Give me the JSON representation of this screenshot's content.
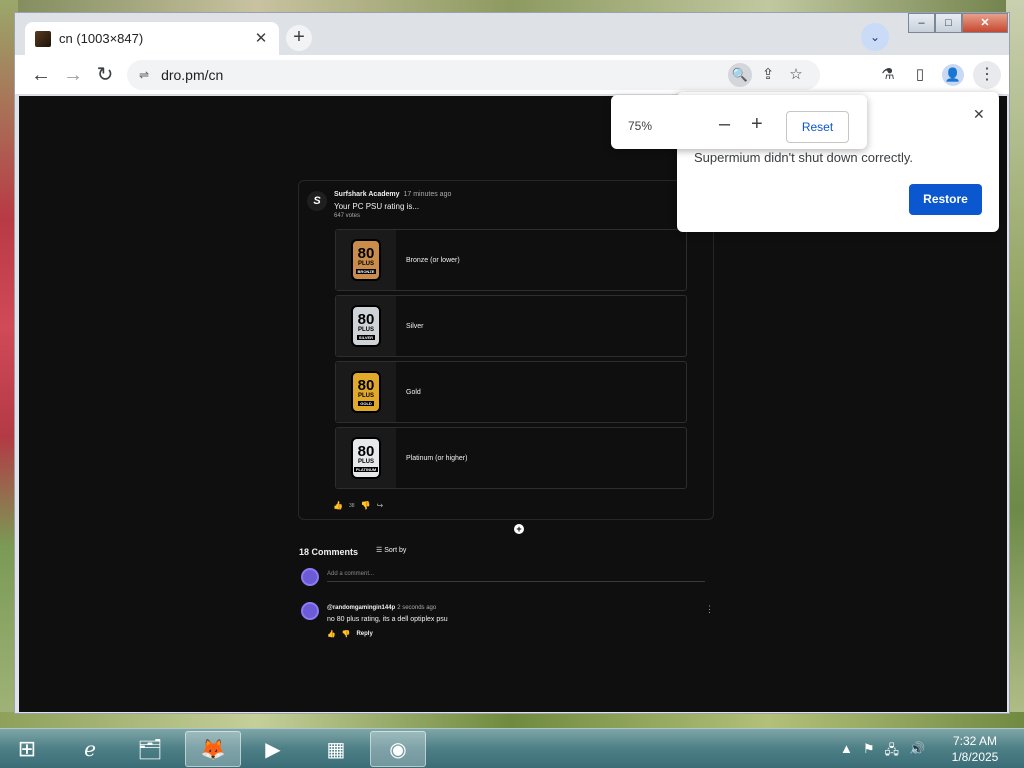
{
  "browser": {
    "tab_title": "cn (1003×847)",
    "tab_close": "✕",
    "new_tab": "+",
    "tab_search": "⌄",
    "url": "dro.pm/cn",
    "window_controls": {
      "minimize": "–",
      "maximize": "□",
      "close": "✕"
    }
  },
  "toolbar": {
    "back": "←",
    "forward": "→",
    "reload": "↻",
    "site_info": "⇌",
    "zoom": "🔍",
    "share": "⇪",
    "bookmark": "☆",
    "labs": "⚗",
    "side_panel": "▯",
    "profile": "👤",
    "menu": "⋮"
  },
  "zoom_popup": {
    "level": "75%",
    "minus": "–",
    "plus": "+",
    "reset": "Reset"
  },
  "restore_popup": {
    "close": "✕",
    "message": "Supermium didn't shut down correctly.",
    "restore": "Restore"
  },
  "post": {
    "channel": "Surfshark Academy",
    "time": "17 minutes ago",
    "question": "Your PC PSU rating is...",
    "votes": "647 votes",
    "avatar_letter": "S",
    "options": [
      {
        "label": "Bronze (or lower)",
        "badge_num": "80",
        "badge_plus": "PLUS",
        "badge_tier": "BRONZE",
        "badge_color": "#c98c4a"
      },
      {
        "label": "Silver",
        "badge_num": "80",
        "badge_plus": "PLUS",
        "badge_tier": "SILVER",
        "badge_color": "#cfd2d6"
      },
      {
        "label": "Gold",
        "badge_num": "80",
        "badge_plus": "PLUS",
        "badge_tier": "GOLD",
        "badge_color": "#e0a92a"
      },
      {
        "label": "Platinum (or higher)",
        "badge_num": "80",
        "badge_plus": "PLUS",
        "badge_tier": "PLATINUM",
        "badge_color": "#e6e8ea"
      }
    ],
    "like_icon": "👍",
    "like_count": "38",
    "dislike_icon": "👎",
    "share_icon": "↪"
  },
  "comments": {
    "count_label": "18 Comments",
    "sort_icon": "☰",
    "sort_label": "Sort by",
    "add_placeholder": "Add a comment...",
    "items": [
      {
        "author": "@randomgamingin144p",
        "time": "2 seconds ago",
        "text": "no 80 plus rating, its a dell optiplex psu",
        "like_icon": "👍",
        "dislike_icon": "👎",
        "reply": "Reply",
        "menu": "⋮"
      }
    ]
  },
  "taskbar": {
    "start": "⊞",
    "apps": [
      "ℯ",
      "🗂",
      "🦊",
      "▶",
      "▦",
      "◉"
    ],
    "tray_icons": [
      "▲",
      "⚑",
      "🖧",
      "🔊"
    ],
    "time": "7:32 AM",
    "date": "1/8/2025"
  }
}
